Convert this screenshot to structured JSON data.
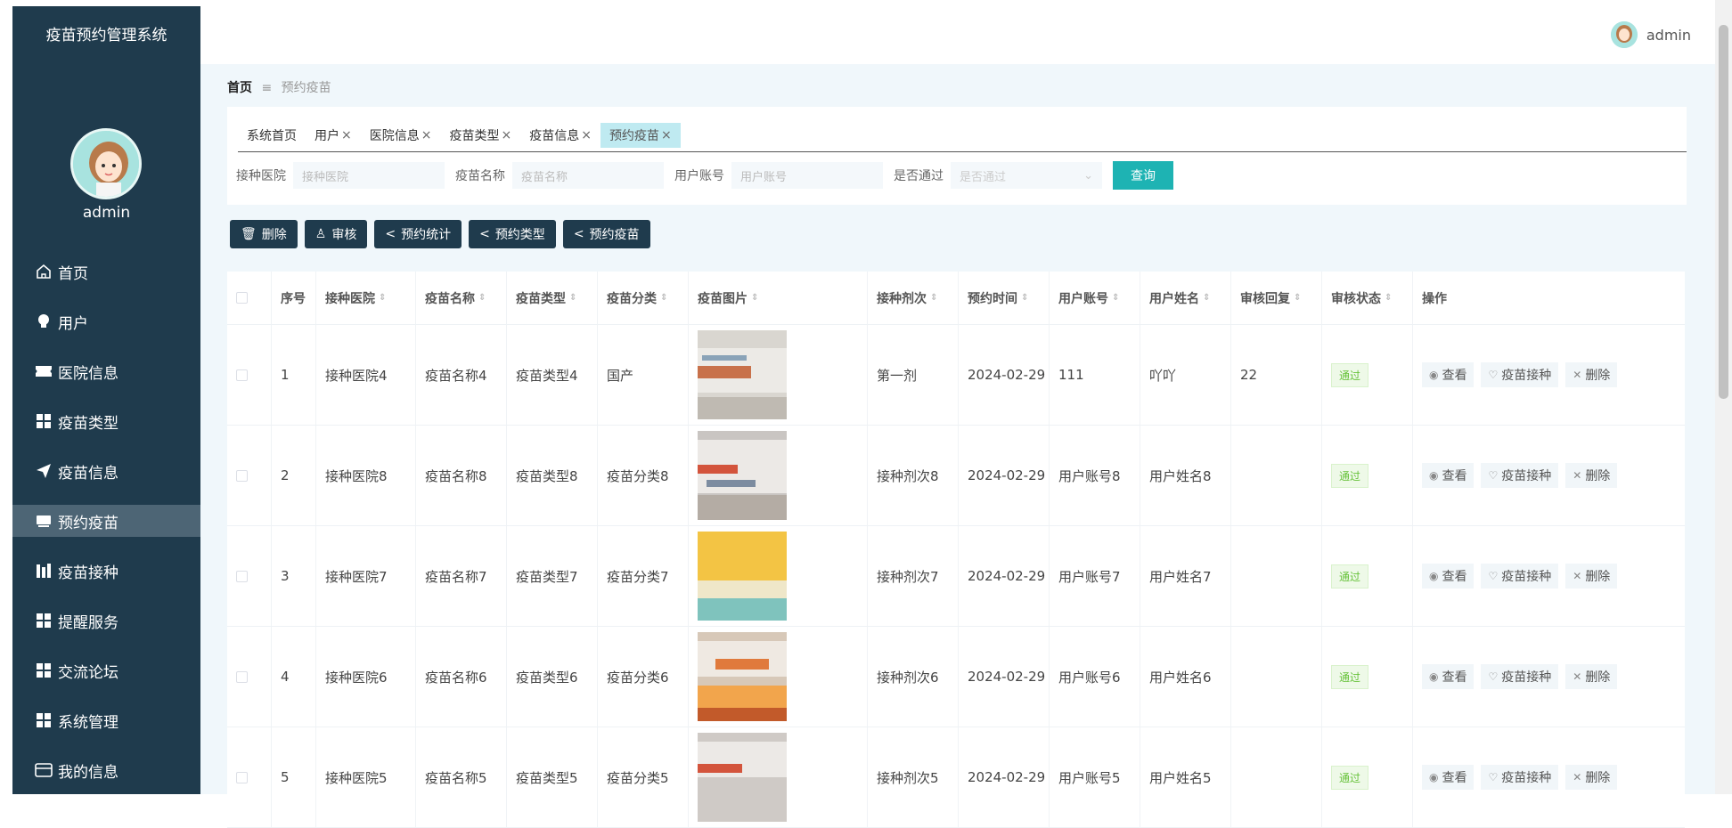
{
  "sidebar": {
    "title": "疫苗预约管理系统",
    "username": "admin",
    "items": [
      {
        "label": "首页",
        "icon": "home-icon"
      },
      {
        "label": "用户",
        "icon": "bulb-icon"
      },
      {
        "label": "医院信息",
        "icon": "ticket-icon"
      },
      {
        "label": "疫苗类型",
        "icon": "grid-icon"
      },
      {
        "label": "疫苗信息",
        "icon": "send-icon"
      },
      {
        "label": "预约疫苗",
        "icon": "card-icon",
        "active": true
      },
      {
        "label": "疫苗接种",
        "icon": "chart-icon"
      },
      {
        "label": "提醒服务",
        "icon": "grid-icon"
      },
      {
        "label": "交流论坛",
        "icon": "grid-icon"
      },
      {
        "label": "系统管理",
        "icon": "grid-icon"
      },
      {
        "label": "我的信息",
        "icon": "wallet-icon"
      }
    ]
  },
  "header": {
    "username": "admin"
  },
  "breadcrumb": {
    "home": "首页",
    "sep": "≡",
    "current": "预约疫苗"
  },
  "tabs": [
    {
      "label": "系统首页",
      "closable": false
    },
    {
      "label": "用户",
      "closable": true
    },
    {
      "label": "医院信息",
      "closable": true
    },
    {
      "label": "疫苗类型",
      "closable": true
    },
    {
      "label": "疫苗信息",
      "closable": true
    },
    {
      "label": "预约疫苗",
      "closable": true,
      "active": true
    }
  ],
  "search": {
    "hospital_label": "接种医院",
    "hospital_placeholder": "接种医院",
    "vaccine_label": "疫苗名称",
    "vaccine_placeholder": "疫苗名称",
    "account_label": "用户账号",
    "account_placeholder": "用户账号",
    "approved_label": "是否通过",
    "approved_placeholder": "是否通过",
    "query_label": "查询"
  },
  "actions": {
    "delete": "删除",
    "review": "审核",
    "stats": "预约统计",
    "type": "预约类型",
    "vaccine": "预约疫苗"
  },
  "table": {
    "headers": [
      "序号",
      "接种医院",
      "疫苗名称",
      "疫苗类型",
      "疫苗分类",
      "疫苗图片",
      "接种剂次",
      "预约时间",
      "用户账号",
      "用户姓名",
      "审核回复",
      "审核状态",
      "操作"
    ],
    "rows": [
      {
        "no": "1",
        "hospital": "接种医院4",
        "name": "疫苗名称4",
        "type": "疫苗类型4",
        "category": "国产",
        "dose": "第一剂",
        "time": "2024-02-29",
        "account": "111",
        "username": "吖吖",
        "reply": "22",
        "status": "通过"
      },
      {
        "no": "2",
        "hospital": "接种医院8",
        "name": "疫苗名称8",
        "type": "疫苗类型8",
        "category": "疫苗分类8",
        "dose": "接种剂次8",
        "time": "2024-02-29",
        "account": "用户账号8",
        "username": "用户姓名8",
        "reply": "",
        "status": "通过"
      },
      {
        "no": "3",
        "hospital": "接种医院7",
        "name": "疫苗名称7",
        "type": "疫苗类型7",
        "category": "疫苗分类7",
        "dose": "接种剂次7",
        "time": "2024-02-29",
        "account": "用户账号7",
        "username": "用户姓名7",
        "reply": "",
        "status": "通过"
      },
      {
        "no": "4",
        "hospital": "接种医院6",
        "name": "疫苗名称6",
        "type": "疫苗类型6",
        "category": "疫苗分类6",
        "dose": "接种剂次6",
        "time": "2024-02-29",
        "account": "用户账号6",
        "username": "用户姓名6",
        "reply": "",
        "status": "通过"
      },
      {
        "no": "5",
        "hospital": "接种医院5",
        "name": "疫苗名称5",
        "type": "疫苗类型5",
        "category": "疫苗分类5",
        "dose": "接种剂次5",
        "time": "2024-02-29",
        "account": "用户账号5",
        "username": "用户姓名5",
        "reply": "",
        "status": "通过"
      }
    ],
    "ops": {
      "view": "查看",
      "vaccinate": "疫苗接种",
      "delete": "删除"
    }
  }
}
